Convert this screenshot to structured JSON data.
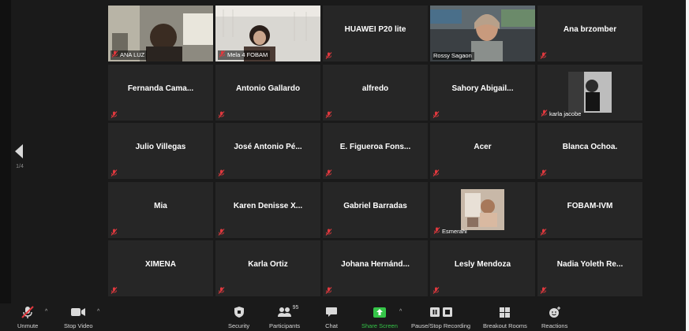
{
  "colors": {
    "background": "#1a1a1a",
    "tile": "#262626",
    "active_speaker_border": "#c9e04a",
    "muted_red": "#e0393e",
    "share_green": "#35c548"
  },
  "navigation": {
    "page_indicator": "1/4"
  },
  "tiles": [
    {
      "name": "ANA LUZ",
      "type": "video",
      "muted": true
    },
    {
      "name": "Mela 4 FOBAM",
      "type": "video",
      "muted": true
    },
    {
      "name": "HUAWEI P20 lite",
      "type": "name",
      "muted": true
    },
    {
      "name": "Rossy Sagaon",
      "type": "video",
      "muted": false,
      "active_speaker": true
    },
    {
      "name": "Ana brzomber",
      "type": "name",
      "muted": true
    },
    {
      "name": "Fernanda Cama...",
      "type": "name",
      "muted": true
    },
    {
      "name": "Antonio Gallardo",
      "type": "name",
      "muted": true
    },
    {
      "name": "alfredo",
      "type": "name",
      "muted": true
    },
    {
      "name": "Sahory Abigail...",
      "type": "name",
      "muted": true
    },
    {
      "name": "karla jacobe",
      "type": "photo",
      "muted": true
    },
    {
      "name": "Julio Villegas",
      "type": "name",
      "muted": true
    },
    {
      "name": "José Antonio Pé...",
      "type": "name",
      "muted": true
    },
    {
      "name": "E. Figueroa Fons...",
      "type": "name",
      "muted": true
    },
    {
      "name": "Acer",
      "type": "name",
      "muted": true
    },
    {
      "name": "Blanca Ochoa.",
      "type": "name",
      "muted": true
    },
    {
      "name": "Mia",
      "type": "name",
      "muted": true
    },
    {
      "name": "Karen Denisse X...",
      "type": "name",
      "muted": true
    },
    {
      "name": "Gabriel Barradas",
      "type": "name",
      "muted": true
    },
    {
      "name": "Esmerahi",
      "type": "photo",
      "muted": true
    },
    {
      "name": "FOBAM-IVM",
      "type": "name",
      "muted": true
    },
    {
      "name": "XIMENA",
      "type": "name",
      "muted": true
    },
    {
      "name": "Karla Ortiz",
      "type": "name",
      "muted": true
    },
    {
      "name": "Johana Hernánd...",
      "type": "name",
      "muted": true
    },
    {
      "name": "Lesly Mendoza",
      "type": "name",
      "muted": true
    },
    {
      "name": "Nadia Yoleth Re...",
      "type": "name",
      "muted": true
    }
  ],
  "toolbar": {
    "unmute": "Unmute",
    "stop_video": "Stop Video",
    "security": "Security",
    "participants": "Participants",
    "participants_count": "95",
    "chat": "Chat",
    "share_screen": "Share Screen",
    "pause_stop_recording": "Pause/Stop Recording",
    "breakout_rooms": "Breakout Rooms",
    "reactions": "Reactions"
  }
}
